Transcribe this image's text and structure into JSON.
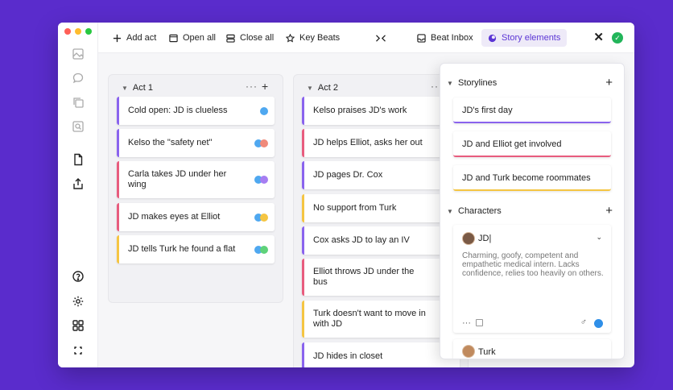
{
  "toolbar": {
    "add_act": "Add act",
    "open_all": "Open all",
    "close_all": "Close all",
    "key_beats": "Key Beats",
    "beat_inbox": "Beat Inbox",
    "story_elements": "Story elements",
    "close": "✕",
    "check": "✓"
  },
  "colors": {
    "purple": "#8a63ee",
    "red": "#e85c7e",
    "yellow": "#f5c542",
    "blue": "#4fa8f0",
    "salmon": "#f08a7a",
    "green": "#5ed27a"
  },
  "acts": [
    {
      "title": "Act 1",
      "cards": [
        {
          "text": "Cold open: JD is clueless",
          "color": "#8a63ee",
          "tags": [
            "#4fa8f0"
          ]
        },
        {
          "text": "Kelso the \"safety net\"",
          "color": "#8a63ee",
          "tags": [
            "#4fa8f0",
            "#f08a7a"
          ]
        },
        {
          "text": "Carla takes JD under her wing",
          "color": "#e85c7e",
          "tags": [
            "#4fa8f0",
            "#a67ef2"
          ]
        },
        {
          "text": "JD makes eyes at Elliot",
          "color": "#e85c7e",
          "tags": [
            "#4fa8f0",
            "#f5c542"
          ]
        },
        {
          "text": "JD tells Turk he found a flat",
          "color": "#f5c542",
          "tags": [
            "#4fa8f0",
            "#5ed27a"
          ]
        }
      ]
    },
    {
      "title": "Act 2",
      "cards": [
        {
          "text": "Kelso praises JD's work",
          "color": "#8a63ee"
        },
        {
          "text": "JD helps Elliot, asks her out",
          "color": "#e85c7e"
        },
        {
          "text": "JD pages Dr. Cox",
          "color": "#8a63ee"
        },
        {
          "text": "No support from Turk",
          "color": "#f5c542"
        },
        {
          "text": "Cox asks JD to lay an IV",
          "color": "#8a63ee"
        },
        {
          "text": "Elliot throws JD under the bus",
          "color": "#e85c7e",
          "tags": [
            "#4fa8f0",
            "#f5c542"
          ]
        },
        {
          "text": "Turk doesn't want to move in with JD",
          "color": "#f5c542"
        },
        {
          "text": "JD hides in closet",
          "color": "#8a63ee"
        }
      ]
    }
  ],
  "panel": {
    "storylines_title": "Storylines",
    "storylines": [
      {
        "text": "JD's first day",
        "color": "#8a63ee"
      },
      {
        "text": "JD and Elliot get involved",
        "color": "#e85c7e"
      },
      {
        "text": "JD and Turk become roommates",
        "color": "#f5c542"
      }
    ],
    "characters_title": "Characters",
    "characters": [
      {
        "name": "JD",
        "description": "Charming, goofy, competent and empathetic medical intern. Lacks confidence, relies too heavily on others."
      },
      {
        "name": "Turk"
      }
    ],
    "gender_symbol": "♂"
  }
}
